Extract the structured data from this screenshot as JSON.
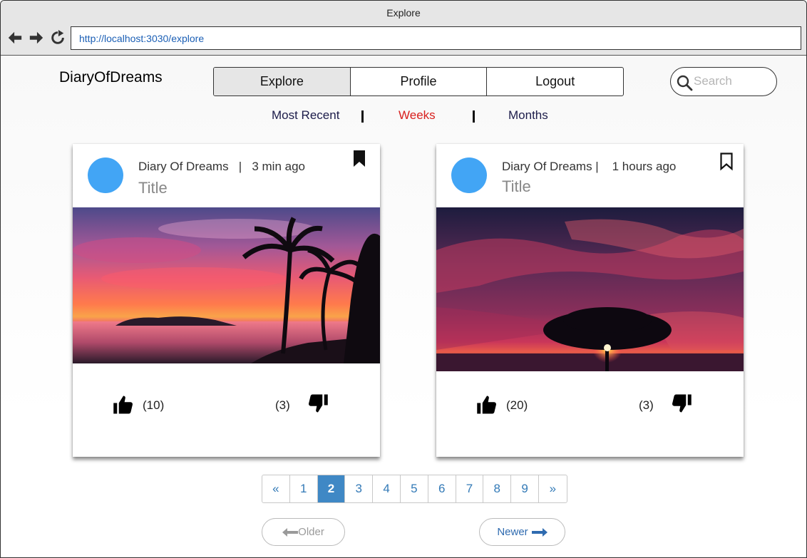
{
  "browser": {
    "window_title": "Explore",
    "url": "http://localhost:3030/explore"
  },
  "app": {
    "brand": "DiaryOfDreams",
    "tabs": [
      {
        "label": "Explore",
        "active": true
      },
      {
        "label": "Profile",
        "active": false
      },
      {
        "label": "Logout",
        "active": false
      }
    ],
    "search": {
      "placeholder": "Search",
      "value": ""
    },
    "filters": [
      {
        "label": "Most Recent",
        "active": false
      },
      {
        "label": "Weeks",
        "active": true
      },
      {
        "label": "Months",
        "active": false
      }
    ]
  },
  "posts": [
    {
      "author": "Diary Of Dreams   |   3 min ago",
      "title": "Title",
      "bookmarked": true,
      "image": "tropical-sunset-palms",
      "likes": "(10)",
      "dislikes": "(3)"
    },
    {
      "author": "Diary Of Dreams |    1 hours ago",
      "title": "Title",
      "bookmarked": false,
      "image": "tree-sunset-sky",
      "likes": "(20)",
      "dislikes": "(3)"
    }
  ],
  "pagination": {
    "prev": "«",
    "pages": [
      "1",
      "2",
      "3",
      "4",
      "5",
      "6",
      "7",
      "8",
      "9"
    ],
    "current": "2",
    "next": "»"
  },
  "older_label": "Older",
  "newer_label": "Newer",
  "colors": {
    "accent": "#3f88c5",
    "active_filter": "#d8201e",
    "avatar": "#42a5f5"
  }
}
